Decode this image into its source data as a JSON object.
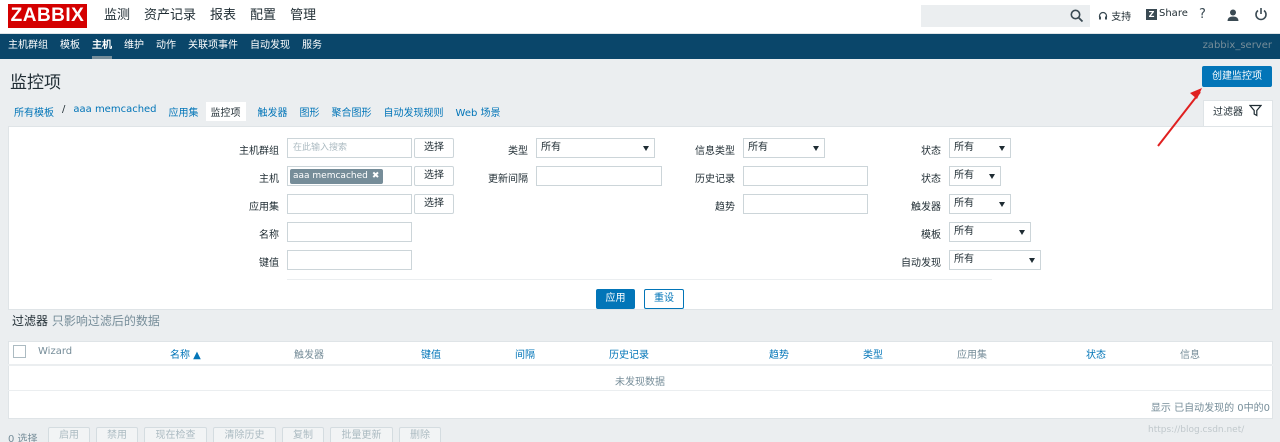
{
  "header": {
    "logo": "ZABBIX",
    "menu": [
      "监测",
      "资产记录",
      "报表",
      "配置",
      "管理"
    ],
    "active_menu": "配置",
    "support": "支持",
    "share": "Share",
    "help": "?"
  },
  "submenu": {
    "items": [
      "主机群组",
      "模板",
      "主机",
      "维护",
      "动作",
      "关联项事件",
      "自动发现",
      "服务"
    ],
    "active": "主机",
    "server": "zabbix_server"
  },
  "page": {
    "title": "监控项",
    "create_button": "创建监控项"
  },
  "breadcrumbs": {
    "all_templates": "所有模板",
    "separator": "/",
    "template": "aaa memcached",
    "tabs": [
      "应用集",
      "监控项",
      "触发器",
      "图形",
      "聚合图形",
      "自动发现规则",
      "Web 场景"
    ],
    "active_tab": "监控项"
  },
  "filter_tab": {
    "label": "过滤器"
  },
  "filter": {
    "host_group_label": "主机群组",
    "host_group_placeholder": "在此输入搜索",
    "select_label": "选择",
    "host_label": "主机",
    "host_chip": "aaa memcached",
    "chip_remove": "✖",
    "application_label": "应用集",
    "name_label": "名称",
    "key_label": "键值",
    "type_label": "类型",
    "type_value": "所有",
    "interval_label": "更新间隔",
    "info_type_label": "信息类型",
    "info_type_value": "所有",
    "history_label": "历史记录",
    "trends_label": "趋势",
    "state_label_1": "状态",
    "state_value_1": "所有",
    "state_label_2": "状态",
    "state_value_2": "所有",
    "triggers_label": "触发器",
    "triggers_value": "所有",
    "template_label": "模板",
    "template_value": "所有",
    "discovery_label": "自动发现",
    "discovery_value": "所有",
    "apply": "应用",
    "reset": "重设",
    "caption": "过滤器",
    "caption_sub": "只影响过滤后的数据"
  },
  "table": {
    "columns": [
      "Wizard",
      "名称 ▲",
      "触发器",
      "键值",
      "间隔",
      "历史记录",
      "趋势",
      "类型",
      "应用集",
      "状态",
      "信息"
    ],
    "no_data": "未发现数据",
    "paging": "显示 已自动发现的 0中的0"
  },
  "actions": {
    "selected": "0 选择",
    "buttons": [
      "启用",
      "禁用",
      "现在检查",
      "清除历史",
      "复制",
      "批量更新",
      "删除"
    ]
  },
  "watermark": "https://blog.csdn.net/"
}
